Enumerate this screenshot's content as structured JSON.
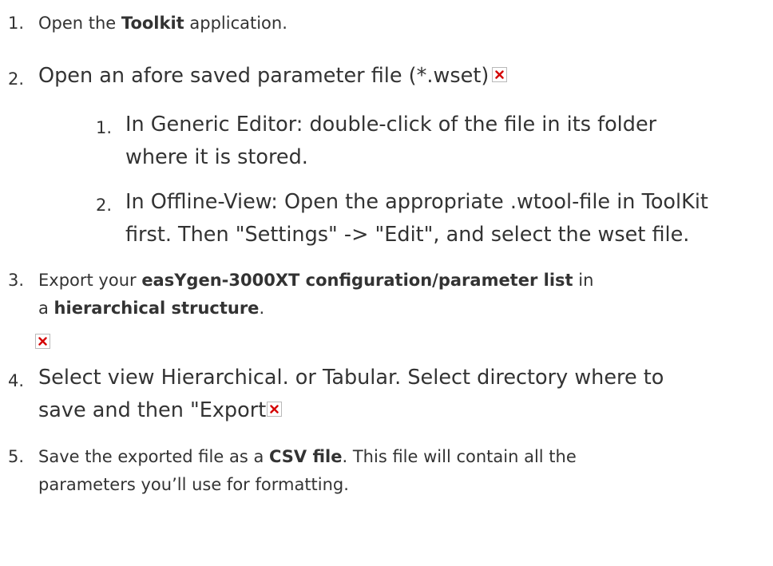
{
  "steps": [
    {
      "num": "1.",
      "text": {
        "a": "Open the ",
        "b": "Toolkit",
        "c": " application."
      }
    },
    {
      "num": "2.",
      "text": {
        "a": "Open an afore saved parameter file (*.wset)"
      },
      "icon": "broken-image-icon",
      "sub": [
        {
          "num": "1.",
          "line1": "In Generic Editor: double-click of the file in its folder",
          "line2": "where it is stored."
        },
        {
          "num": "2.",
          "line1": "In Offline-View: Open the appropriate .wtool-file in ToolKit",
          "line2": "first. Then \"Settings\" -> \"Edit\", and select the wset file."
        }
      ]
    },
    {
      "num": "3.",
      "text": {
        "a": "Export your ",
        "b": "easYgen-3000XT configuration/parameter list",
        "c": " in",
        "d": "a ",
        "e": "hierarchical structure",
        "f": "."
      },
      "icon": "broken-image-icon"
    },
    {
      "num": "4.",
      "line1": "Select view Hierarchical. or Tabular. Select directory where to",
      "line2": "save and then \"Export",
      "icon": "broken-image-icon"
    },
    {
      "num": "5.",
      "text": {
        "a": "Save the exported file as a ",
        "b": "CSV file",
        "c": ". This file will contain all the",
        "d": "parameters you’ll use for formatting."
      }
    }
  ],
  "colors": {
    "text": "#333333",
    "icon_border": "#b9b9b9",
    "icon_x": "#d40000"
  }
}
